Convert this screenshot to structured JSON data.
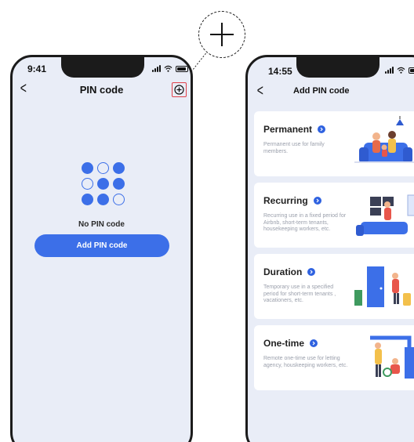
{
  "left_screen": {
    "status_time": "9:41",
    "title": "PIN code",
    "empty_state_text": "No PIN code",
    "add_button_label": "Add PIN code",
    "dot_pattern": [
      "filled",
      "hollow",
      "filled",
      "hollow",
      "filled",
      "filled",
      "filled",
      "filled",
      "hollow"
    ]
  },
  "right_screen": {
    "status_time": "14:55",
    "title": "Add PIN code",
    "cards": [
      {
        "title": "Permanent",
        "description": "Permanent use for family members."
      },
      {
        "title": "Recurring",
        "description": "Recurring use in a fixed period for Airbnb, short-term tenants, housekeeping workers, etc."
      },
      {
        "title": "Duration",
        "description": "Temporary use in a specified period for short-term tenants , vacationers, etc."
      },
      {
        "title": "One-time",
        "description": "Remote one-time use for letting agency, houskeeping workers, etc."
      }
    ]
  },
  "colors": {
    "accent": "#3c6fe8",
    "highlight": "#e0414a",
    "screen_bg": "#e9edf7"
  },
  "icons": [
    "back-chevron-icon",
    "add-circle-icon",
    "plus-icon",
    "info-badge-icon",
    "signal-icon",
    "wifi-icon",
    "battery-icon"
  ]
}
